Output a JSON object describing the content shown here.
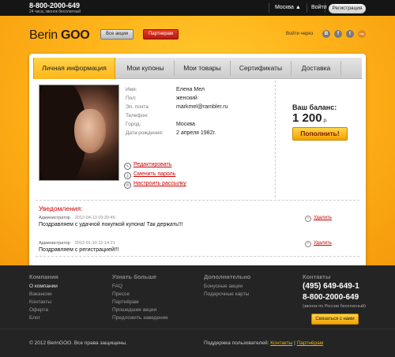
{
  "topbar": {
    "phone": "8-800-2000-649",
    "phone_sub": "24 часа, звонок бесплатный",
    "city": "Москва ▲",
    "login": "Войти",
    "register": "Регистрация"
  },
  "header": {
    "logo_light": "Berin ",
    "logo_bold": "GOO",
    "shares_button": "Все акции",
    "partners_button": "Партнерам",
    "login_via": "Войти через",
    "social": [
      "В",
      "f",
      "t",
      "rss"
    ]
  },
  "tabs": [
    "Личная информация",
    "Мои купоны",
    "Мои товары",
    "Сертификаты",
    "Доставка"
  ],
  "profile": {
    "fields": [
      {
        "label": "Имя:",
        "value": "Елена Мел"
      },
      {
        "label": "Пол:",
        "value": "женский"
      },
      {
        "label": "Эл. почта:",
        "value": "markmel@rambler.ru"
      },
      {
        "label": "Телефон:",
        "value": ""
      },
      {
        "label": "Город:",
        "value": "Москва"
      },
      {
        "label": "Дата рождения:",
        "value": "2 апреля 1982г."
      }
    ],
    "actions": [
      "Редактировать",
      "Сменить пароль",
      "Настроить рассылку"
    ]
  },
  "balance": {
    "title": "Ваш баланс:",
    "amount": "1 200",
    "currency": "р.",
    "topup_button": "Пополнить!"
  },
  "notifications": {
    "title": "Уведомления:",
    "items": [
      {
        "author": "Администратор",
        "date": "2012-04-13 03:20:45",
        "text": "Поздравляем с удачной покупкой купона! Так держать!!!",
        "delete": "Удалить"
      },
      {
        "author": "Администратор",
        "date": "2012-01-10 12:14:21",
        "text": "Поздравляем с регистрацией!!!",
        "delete": "Удалить"
      }
    ]
  },
  "footer": {
    "columns": [
      {
        "title": "Компания",
        "links": [
          "О компании",
          "Вакансии",
          "Контакты",
          "Оферта",
          "Блог"
        ]
      },
      {
        "title": "Узнать больше",
        "links": [
          "FAQ",
          "Прессе",
          "Партнёрам",
          "Прошедшие акции",
          "Предложить заведение"
        ]
      },
      {
        "title": "Дополнительно",
        "links": [
          "Бонусные акции",
          "Подарочные карты"
        ]
      }
    ],
    "contacts_title": "Контакты",
    "phone1": "(495) 649-649-1",
    "phone2": "8-800-2000-649",
    "free_note": "(звонок по России бесплатный)",
    "contact_button": "Связаться с нами",
    "copyright": "© 2012 BerinGOO. Все права защищены.",
    "support_label": "Поддержка пользователей: ",
    "support_contacts": "Контакты",
    "support_sep": " | ",
    "support_partners": "Партнёрам"
  }
}
